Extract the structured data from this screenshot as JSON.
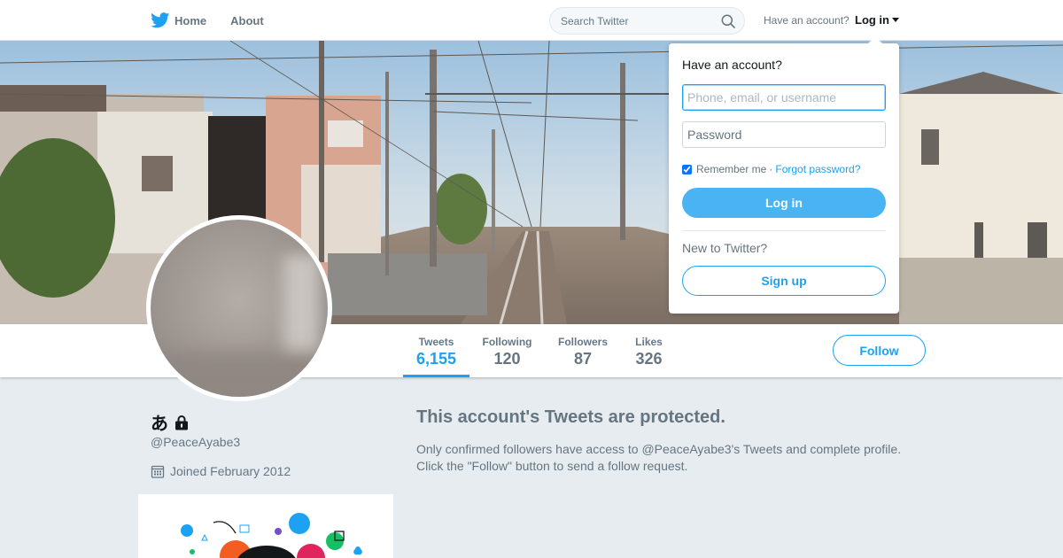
{
  "nav": {
    "home_label": "Home",
    "about_label": "About",
    "search_placeholder": "Search Twitter",
    "have_account_text": "Have an account?",
    "login_label": "Log in"
  },
  "profile": {
    "display_name": "あ",
    "handle": "@PeaceAyabe3",
    "joined": "Joined February 2012"
  },
  "stats": [
    {
      "label": "Tweets",
      "value": "6,155"
    },
    {
      "label": "Following",
      "value": "120"
    },
    {
      "label": "Followers",
      "value": "87"
    },
    {
      "label": "Likes",
      "value": "326"
    }
  ],
  "follow_label": "Follow",
  "protected": {
    "title": "This account's Tweets are protected.",
    "line1": "Only confirmed followers have access to @PeaceAyabe3's Tweets and complete profile.",
    "line2": "Click the \"Follow\" button to send a follow request."
  },
  "login_dropdown": {
    "heading": "Have an account?",
    "username_placeholder": "Phone, email, or username",
    "password_placeholder": "Password",
    "remember_label": "Remember me",
    "separator": "·",
    "forgot_label": "Forgot password?",
    "login_button": "Log in",
    "new_text": "New to Twitter?",
    "signup_button": "Sign up"
  },
  "colors": {
    "accent": "#1da1f2",
    "button_fill": "#4ab3f4",
    "background": "#e6ecf0",
    "muted_text": "#66757f"
  },
  "icons": [
    "twitter-bird-icon",
    "search-icon",
    "lock-icon",
    "calendar-icon"
  ]
}
